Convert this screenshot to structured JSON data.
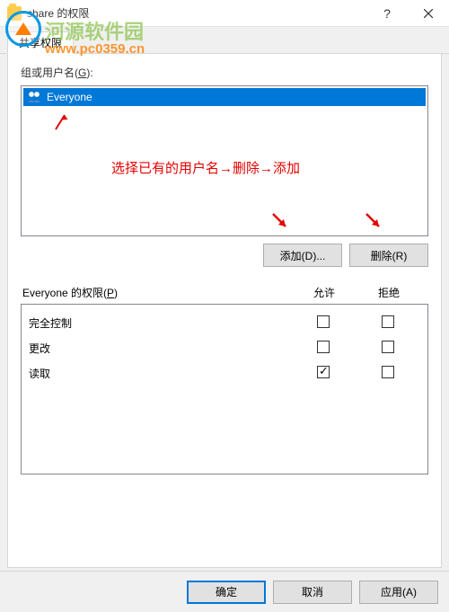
{
  "titlebar": {
    "title": "share 的权限"
  },
  "watermark": {
    "text": "河源软件园",
    "url": "www.pc0359.cn"
  },
  "tab": {
    "label": "共享权限"
  },
  "labels": {
    "group_user": "组或用户名(",
    "group_user_key": "G",
    "group_user_end": "):",
    "perm_for": "Everyone 的权限(",
    "perm_key": "P",
    "perm_end": ")",
    "allow": "允许",
    "deny": "拒绝"
  },
  "users": [
    {
      "name": "Everyone"
    }
  ],
  "annotation": {
    "text": "选择已有的用户名→删除→添加"
  },
  "buttons": {
    "add": "添加(D)...",
    "remove": "删除(R)",
    "ok": "确定",
    "cancel": "取消",
    "apply": "应用(A)"
  },
  "permissions": [
    {
      "name": "完全控制",
      "allow": false,
      "deny": false
    },
    {
      "name": "更改",
      "allow": false,
      "deny": false
    },
    {
      "name": "读取",
      "allow": true,
      "deny": false
    }
  ]
}
